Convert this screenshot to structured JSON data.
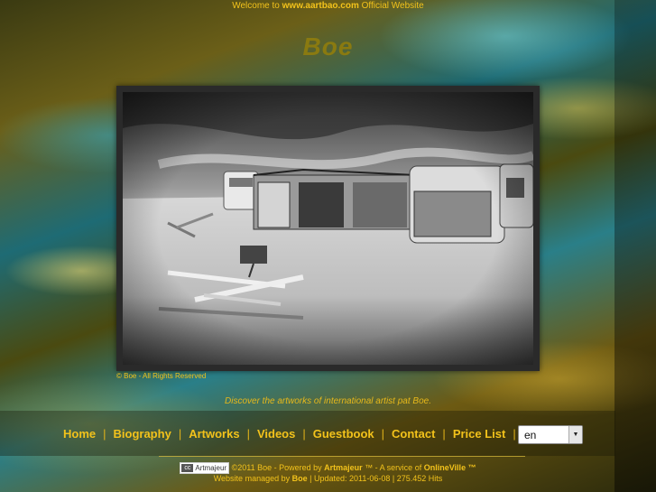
{
  "header": {
    "welcome_prefix": "Welcome to",
    "domain": "www.aartbao.com",
    "welcome_suffix": "Official Website",
    "site_title": "Boe"
  },
  "artwork": {
    "copyright": "© Boe - All Rights Reserved"
  },
  "discover_text": "Discover the artworks of international artist pat Boe.",
  "nav": {
    "items": [
      "Home",
      "Biography",
      "Artworks",
      "Videos",
      "Guestbook",
      "Contact",
      "Price List"
    ],
    "separator": "|",
    "language_selected": "en"
  },
  "footer": {
    "badge_label": "Artmajeur",
    "badge_icon": "cc",
    "copyright": "©2011 Boe - Powered by",
    "powered_by": "Artmajeur",
    "tm_service": "™ - A service of",
    "service": "OnlineVille",
    "tm": "™",
    "managed_prefix": "Website managed by",
    "managed_by": "Boe",
    "updated": "| Updated: 2011-06-08 | 275.452 Hits"
  },
  "colors": {
    "accent": "#f2c21b",
    "title": "#8a7a10",
    "frame": "#2a2a2a"
  }
}
